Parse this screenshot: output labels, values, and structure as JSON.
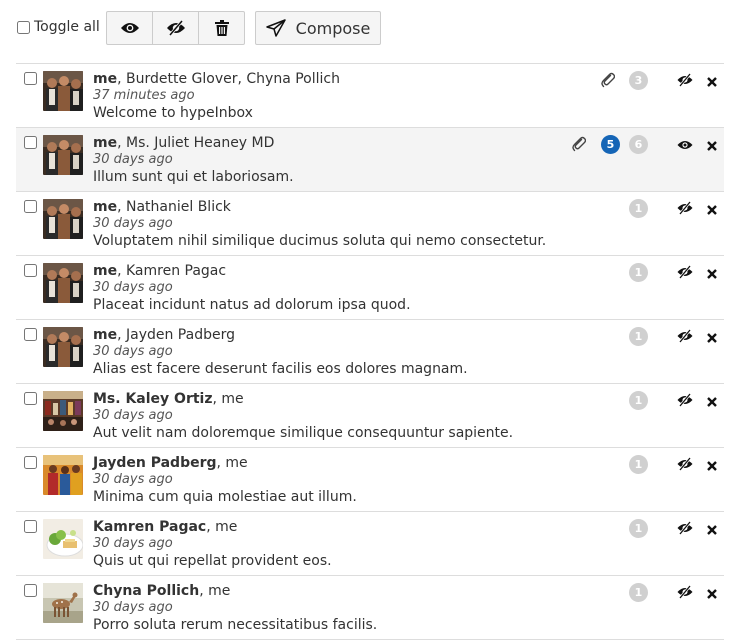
{
  "toolbar": {
    "toggle_all_label": "Toggle all",
    "compose_label": "Compose",
    "icons": [
      "eye-icon",
      "eye-slash-icon",
      "trash-icon",
      "paper-plane-icon"
    ]
  },
  "colors": {
    "unread_badge": "#1565b6",
    "count_badge": "#d0d0d0",
    "selected_row": "#f4f4f4"
  },
  "threads": [
    {
      "sender_bold": "me",
      "sender_rest": ", Burdette Glover, Chyna Pollich",
      "time": "37 minutes ago",
      "subject": "Welcome to hypeInbox",
      "attachment": true,
      "unread": "",
      "count": "3",
      "read": true,
      "avatar": "group-photo"
    },
    {
      "sender_bold": "me",
      "sender_rest": ", Ms. Juliet Heaney MD",
      "time": "30 days ago",
      "subject": "Illum sunt qui et laboriosam.",
      "attachment": true,
      "unread": "5",
      "count": "6",
      "read": false,
      "avatar": "group-photo"
    },
    {
      "sender_bold": "me",
      "sender_rest": ", Nathaniel Blick",
      "time": "30 days ago",
      "subject": "Voluptatem nihil similique ducimus soluta qui nemo consectetur.",
      "attachment": false,
      "unread": "",
      "count": "1",
      "read": true,
      "avatar": "group-photo"
    },
    {
      "sender_bold": "me",
      "sender_rest": ", Kamren Pagac",
      "time": "30 days ago",
      "subject": "Placeat incidunt natus ad dolorum ipsa quod.",
      "attachment": false,
      "unread": "",
      "count": "1",
      "read": true,
      "avatar": "group-photo"
    },
    {
      "sender_bold": "me",
      "sender_rest": ", Jayden Padberg",
      "time": "30 days ago",
      "subject": "Alias est facere deserunt facilis eos dolores magnam.",
      "attachment": false,
      "unread": "",
      "count": "1",
      "read": true,
      "avatar": "group-photo"
    },
    {
      "sender_bold": "Ms. Kaley Ortiz",
      "sender_rest": ", me",
      "time": "30 days ago",
      "subject": "Aut velit nam doloremque similique consequuntur sapiente.",
      "attachment": false,
      "unread": "",
      "count": "1",
      "read": true,
      "avatar": "market-photo"
    },
    {
      "sender_bold": "Jayden Padberg",
      "sender_rest": ", me",
      "time": "30 days ago",
      "subject": "Minima cum quia molestiae aut illum.",
      "attachment": false,
      "unread": "",
      "count": "1",
      "read": true,
      "avatar": "people-photo"
    },
    {
      "sender_bold": "Kamren Pagac",
      "sender_rest": ", me",
      "time": "30 days ago",
      "subject": "Quis ut qui repellat provident eos.",
      "attachment": false,
      "unread": "",
      "count": "1",
      "read": true,
      "avatar": "food-photo"
    },
    {
      "sender_bold": "Chyna Pollich",
      "sender_rest": ", me",
      "time": "30 days ago",
      "subject": "Porro soluta rerum necessitatibus facilis.",
      "attachment": false,
      "unread": "",
      "count": "1",
      "read": true,
      "avatar": "deer-photo"
    }
  ]
}
